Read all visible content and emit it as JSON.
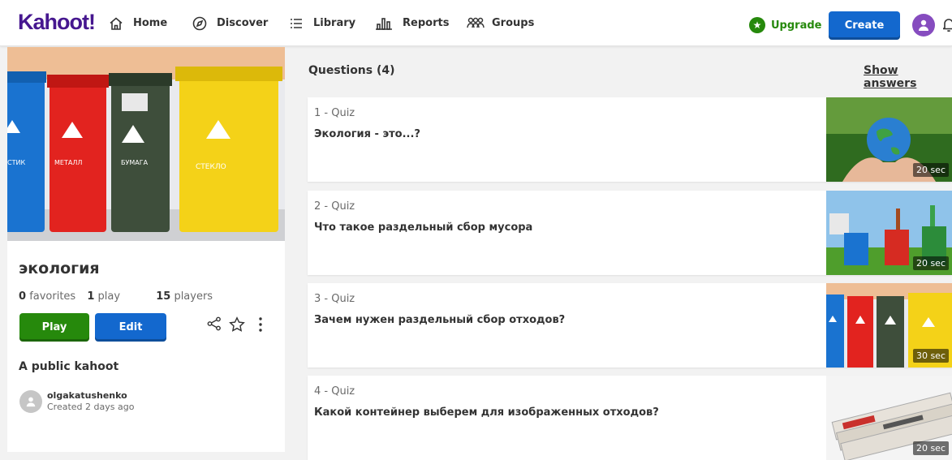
{
  "header": {
    "logo": "Kahoot!",
    "nav": [
      {
        "label": "Home",
        "icon": "home-icon"
      },
      {
        "label": "Discover",
        "icon": "compass-icon"
      },
      {
        "label": "Library",
        "icon": "list-icon"
      },
      {
        "label": "Reports",
        "icon": "bar-chart-icon"
      },
      {
        "label": "Groups",
        "icon": "groups-icon"
      }
    ],
    "upgrade_label": "Upgrade",
    "create_label": "Create"
  },
  "kahoot": {
    "title": "экология",
    "favorites_count": "0",
    "favorites_label": "favorites",
    "plays_count": "1",
    "plays_label": "play",
    "players_count": "15",
    "players_label": "players",
    "play_label": "Play",
    "edit_label": "Edit",
    "visibility": "A public kahoot",
    "creator": "olgakatushenko",
    "created": "Created 2 days ago",
    "cover_bin_labels": [
      "СТИК",
      "МЕТАЛЛ",
      "БУМАГА",
      "СТЕКЛО"
    ]
  },
  "questions": {
    "heading": "Questions (4)",
    "show_answers": "Show answers",
    "items": [
      {
        "type": "1 - Quiz",
        "text": "Экология - это...?",
        "time": "20 sec"
      },
      {
        "type": "2 - Quiz",
        "text": "Что такое раздельный сбор мусора",
        "time": "20 sec"
      },
      {
        "type": "3 - Quiz",
        "text": "Зачем нужен раздельный сбор отходов?",
        "time": "30 sec"
      },
      {
        "type": "4 - Quiz",
        "text": "Какой контейнер выберем для изображенных отходов?",
        "time": "20 sec"
      }
    ]
  },
  "colors": {
    "brand": "#46178f",
    "play": "#26890c",
    "primary": "#1368ce",
    "avatar": "#864cbf"
  }
}
